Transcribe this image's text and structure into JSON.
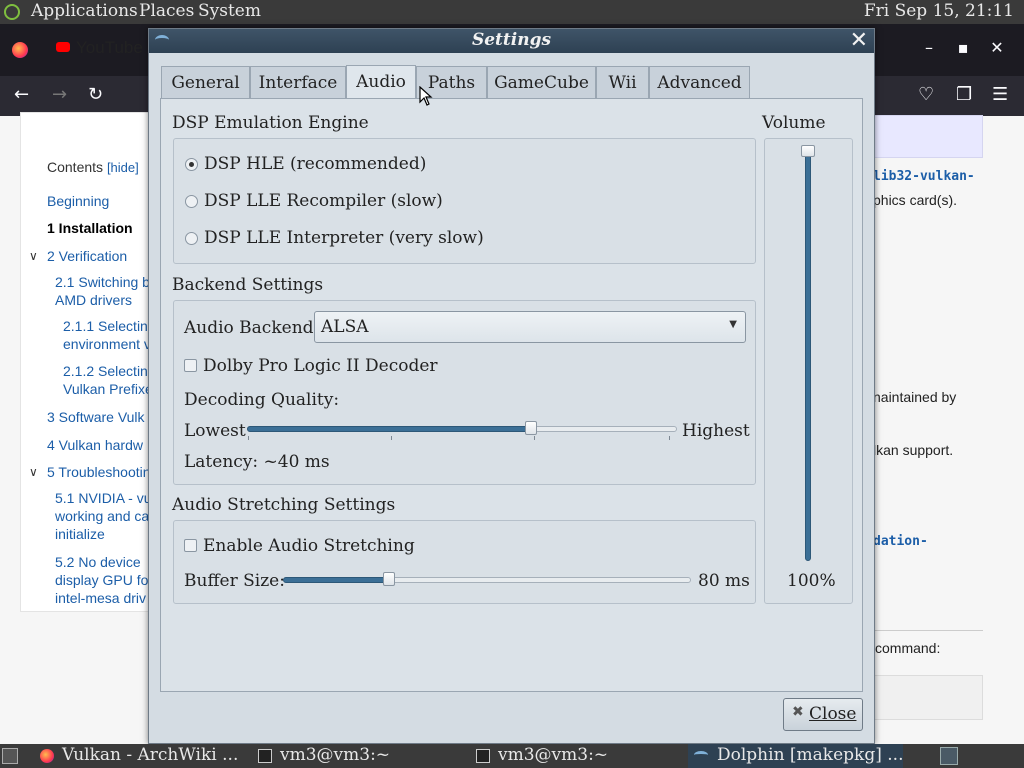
{
  "top_panel": {
    "menus": [
      "Applications",
      "Places",
      "System"
    ],
    "clock": "Fri Sep 15, 21:11"
  },
  "browser": {
    "tab_title": "YouTube",
    "toc": {
      "title": "Contents",
      "hide": "[hide]",
      "items": [
        {
          "text": "Beginning"
        },
        {
          "text": "1  Installation"
        },
        {
          "text": "2  Verification"
        },
        {
          "text": "2.1  Switching b"
        },
        {
          "text": "AMD drivers"
        },
        {
          "text": "2.1.1  Selectin"
        },
        {
          "text": "environment v"
        },
        {
          "text": "2.1.2  Selectin"
        },
        {
          "text": "Vulkan Prefixe"
        },
        {
          "text": "3  Software Vulk"
        },
        {
          "text": "4  Vulkan hardw"
        },
        {
          "text": "5  Troubleshootin"
        },
        {
          "text": "5.1  NVIDIA - vu"
        },
        {
          "text": "working and ca"
        },
        {
          "text": "initialize"
        },
        {
          "text": "5.2  No device"
        },
        {
          "text": "display GPU fo"
        },
        {
          "text": "intel-mesa driv"
        }
      ]
    },
    "right_texts": {
      "code1": "lib32-vulkan-",
      "text1": "phics card(s).",
      "text2": "naintained by",
      "text3": "lkan support.",
      "code2": "dation-",
      "text4": "command:"
    }
  },
  "dialog": {
    "title": "Settings",
    "tabs": [
      {
        "label": "General"
      },
      {
        "label": "Interface"
      },
      {
        "label": "Audio",
        "active": true
      },
      {
        "label": "Paths"
      },
      {
        "label": "GameCube"
      },
      {
        "label": "Wii"
      },
      {
        "label": "Advanced"
      }
    ],
    "dsp": {
      "title": "DSP Emulation Engine",
      "options": [
        {
          "label": "DSP HLE (recommended)",
          "checked": true
        },
        {
          "label": "DSP LLE Recompiler (slow)",
          "checked": false
        },
        {
          "label": "DSP LLE Interpreter (very slow)",
          "checked": false
        }
      ]
    },
    "volume": {
      "title": "Volume",
      "value_label": "100%",
      "level": 1.0
    },
    "backend": {
      "title": "Backend Settings",
      "audio_backend_label": "Audio Backend:",
      "audio_backend_value": "ALSA",
      "dolby_label": "Dolby Pro Logic II Decoder",
      "dolby_checked": false,
      "decoding_quality_label": "Decoding Quality:",
      "lowest_label": "Lowest",
      "highest_label": "Highest",
      "decoding_quality_level": 0.66,
      "latency_label": "Latency: ~40 ms"
    },
    "stretching": {
      "title": "Audio Stretching Settings",
      "enable_label": "Enable Audio Stretching",
      "enable_checked": false,
      "buffer_label": "Buffer Size:",
      "buffer_value": "80 ms",
      "buffer_level": 0.26
    },
    "close_label": "Close"
  },
  "taskbar": {
    "tasks": [
      {
        "label": "Vulkan - ArchWiki ..."
      },
      {
        "label": "vm3@vm3:~"
      },
      {
        "label": "vm3@vm3:~"
      },
      {
        "label": "Dolphin [makepkg] ...",
        "active": true
      }
    ]
  }
}
